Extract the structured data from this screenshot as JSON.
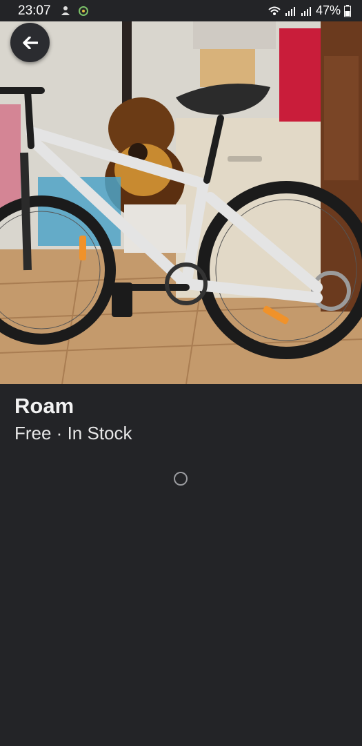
{
  "status_bar": {
    "time": "23:07",
    "battery": "47%",
    "icons": [
      "notification-icon",
      "app-icon",
      "wifi-icon",
      "signal-icon",
      "signal-icon",
      "battery-icon"
    ]
  },
  "listing": {
    "title": "Roam",
    "subtitle": "Free · In Stock",
    "photo_subject": "bicycle-photo"
  },
  "colors": {
    "background": "#232427",
    "text_primary": "#f2f2f2"
  }
}
